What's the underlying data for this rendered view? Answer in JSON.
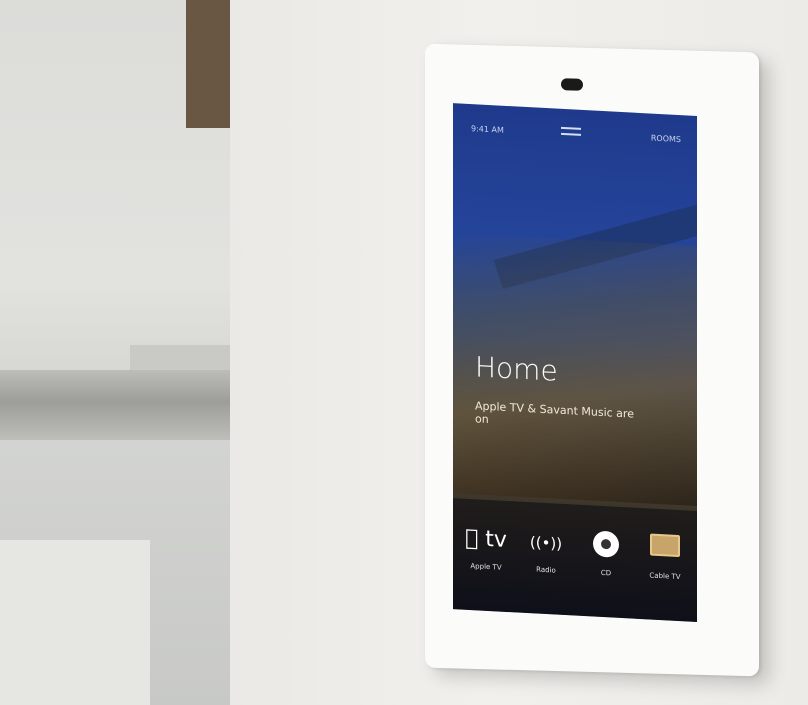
{
  "screen": {
    "status_left": "9:41 AM",
    "status_right": "ROOMS",
    "title": "Home",
    "subtitle": "Apple TV & Savant Music are on",
    "sources": [
      {
        "label": "Apple TV",
        "icon": "apple-tv-icon",
        "glyph": " tv"
      },
      {
        "label": "Radio",
        "icon": "radio-icon",
        "glyph": "((•))"
      },
      {
        "label": "CD",
        "icon": "cd-icon",
        "glyph": ""
      },
      {
        "label": "Cable TV",
        "icon": "cable-tv-icon",
        "glyph": ""
      }
    ]
  }
}
